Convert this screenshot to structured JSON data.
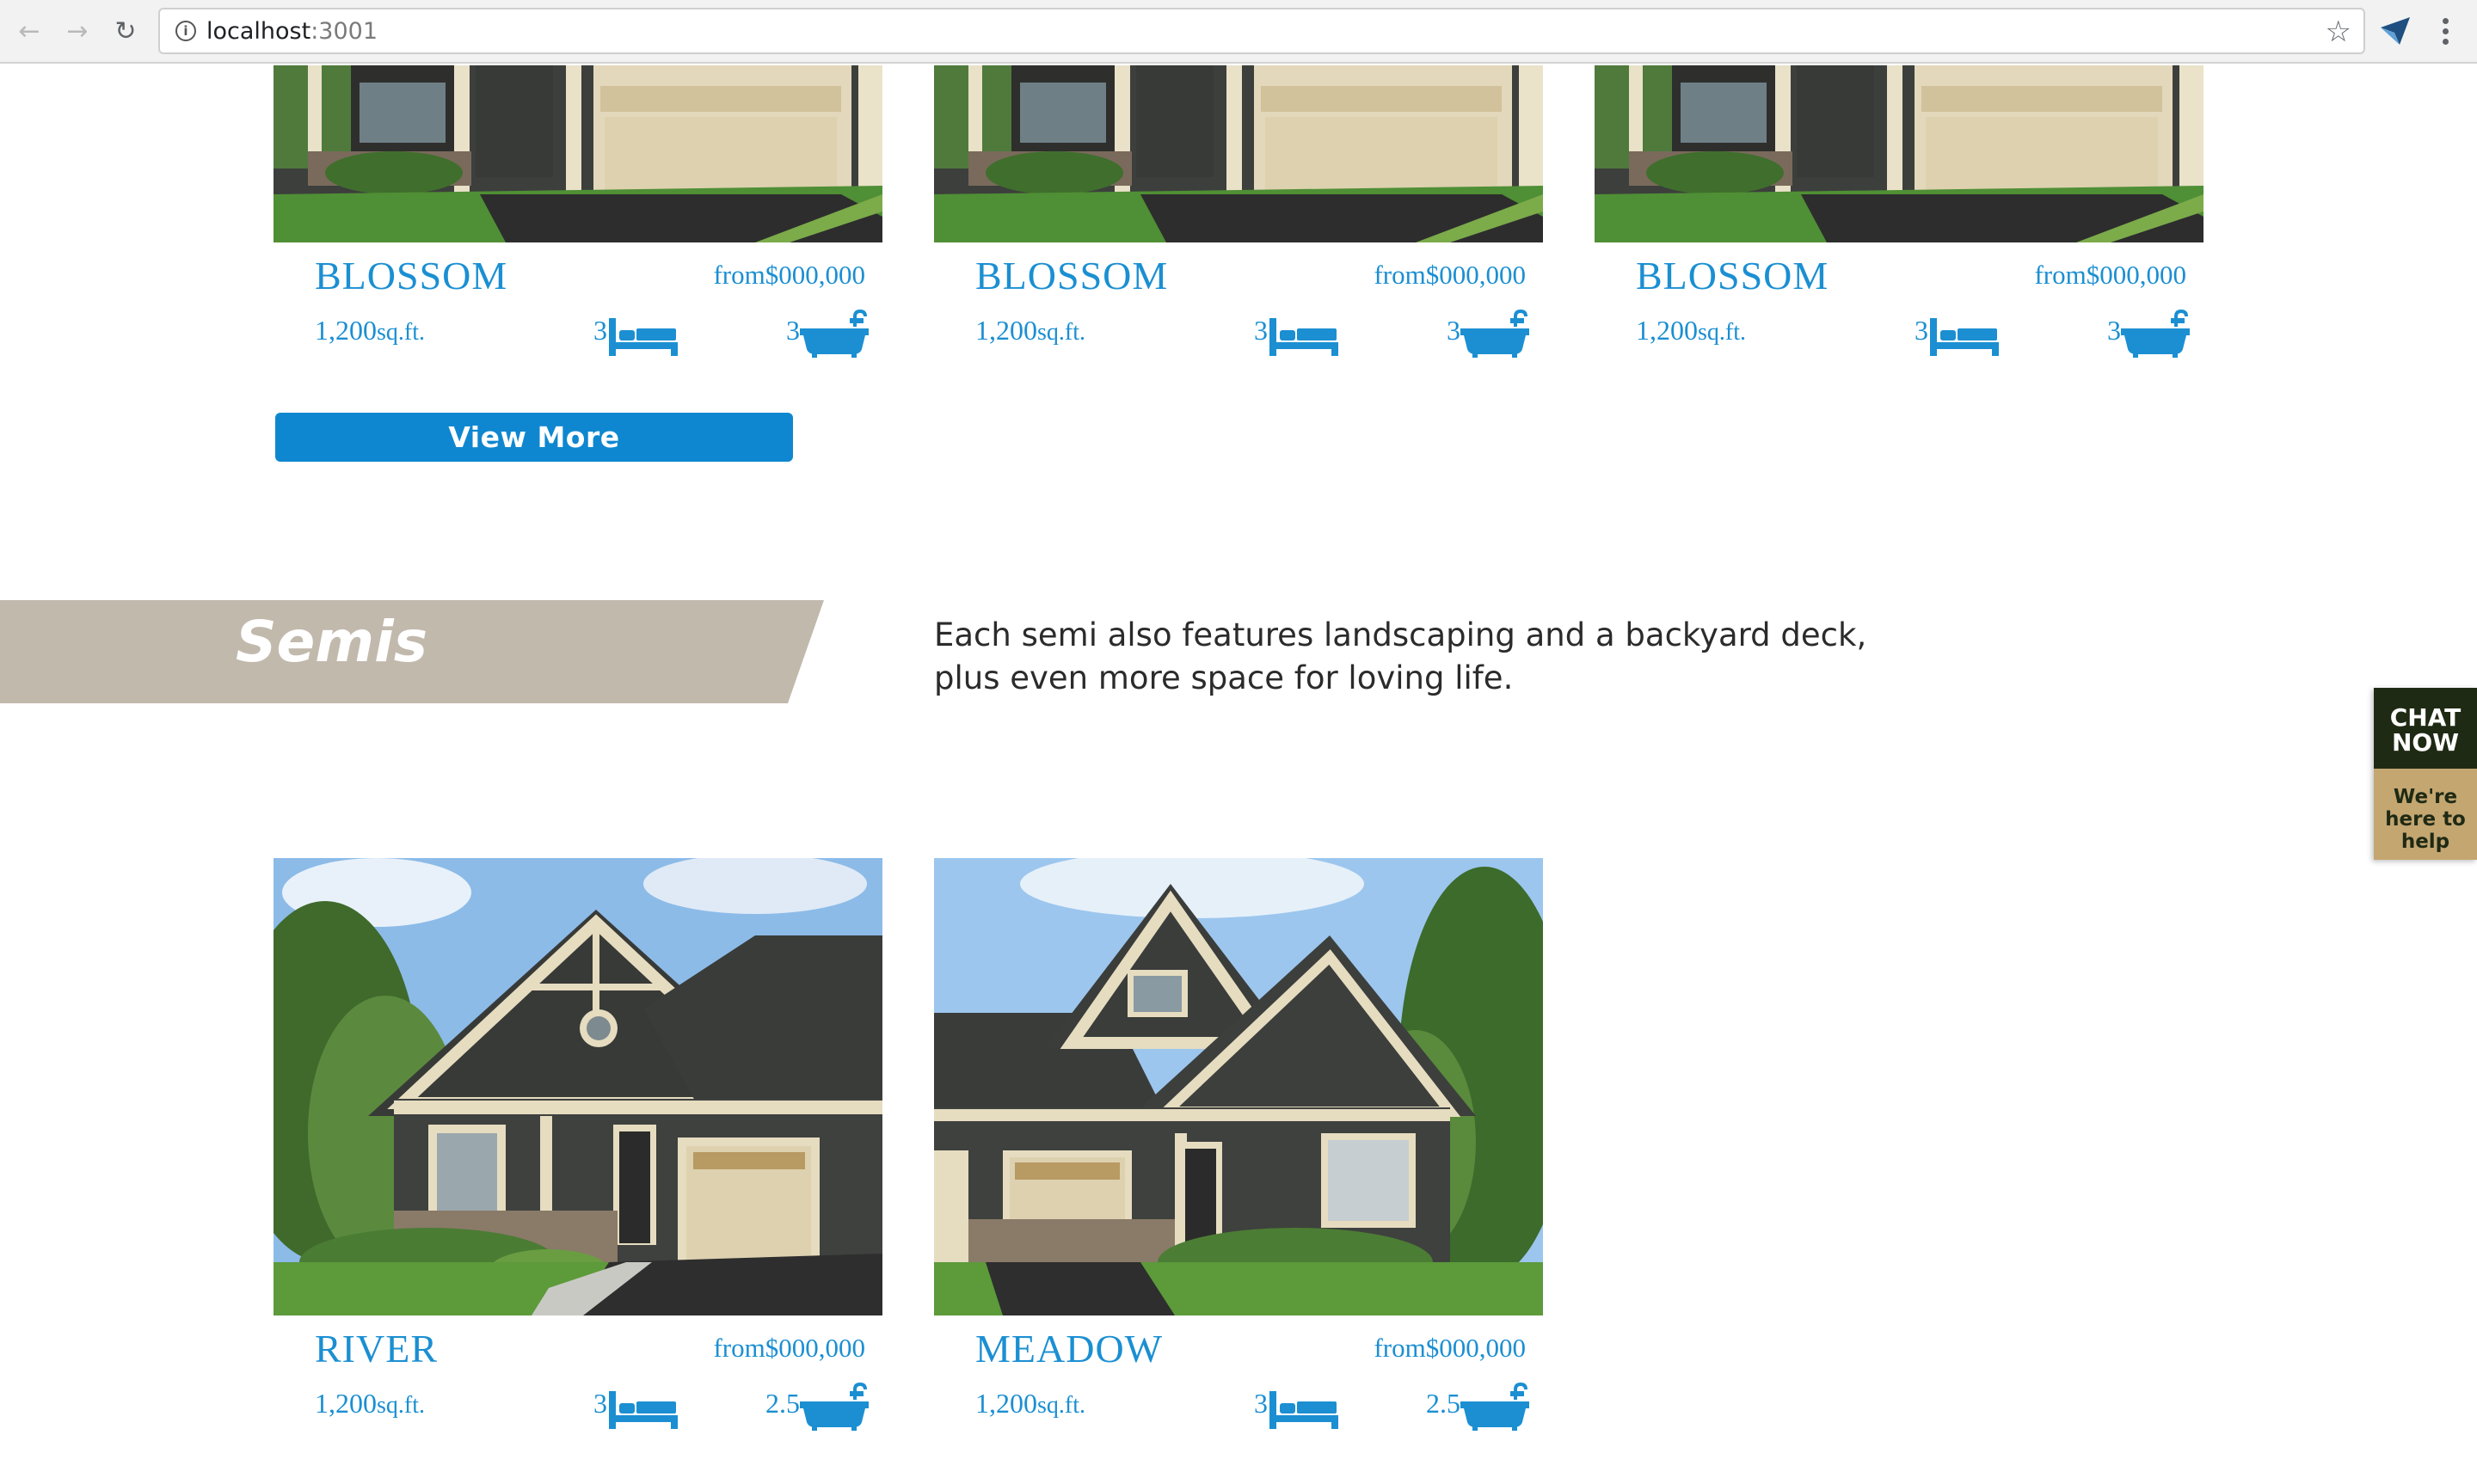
{
  "browser": {
    "url_host": "localhost",
    "url_port": ":3001",
    "nav_icons": [
      "back-arrow-icon",
      "forward-arrow-icon",
      "reload-icon"
    ],
    "info_icon": "info-icon",
    "bookmark_icon": "star-icon",
    "extension_icon": "extension-icon",
    "menu_icon": "kebab-menu-icon"
  },
  "singles": {
    "cards": [
      {
        "name": "BLOSSOM",
        "price": "from$000,000",
        "sqft_value": "1,200",
        "sqft_unit": "sq.ft.",
        "beds": "3",
        "baths": "3"
      },
      {
        "name": "BLOSSOM",
        "price": "from$000,000",
        "sqft_value": "1,200",
        "sqft_unit": "sq.ft.",
        "beds": "3",
        "baths": "3"
      },
      {
        "name": "BLOSSOM",
        "price": "from$000,000",
        "sqft_value": "1,200",
        "sqft_unit": "sq.ft.",
        "beds": "3",
        "baths": "3"
      }
    ],
    "view_more_label": "View More"
  },
  "semis": {
    "title": "Semis",
    "description_line1": "Each semi also features landscaping and a backyard deck,",
    "description_line2": "plus even more space for loving life.",
    "cards": [
      {
        "name": "RIVER",
        "price": "from$000,000",
        "sqft_value": "1,200",
        "sqft_unit": "sq.ft.",
        "beds": "3",
        "baths": "2.5"
      },
      {
        "name": "MEADOW",
        "price": "from$000,000",
        "sqft_value": "1,200",
        "sqft_unit": "sq.ft.",
        "beds": "3",
        "baths": "2.5"
      }
    ]
  },
  "chat_widget": {
    "line1": "CHAT",
    "line2": "NOW",
    "sub1": "We're",
    "sub2": "here to",
    "sub3": "help"
  },
  "colors": {
    "accent_blue": "#1b8fd2",
    "button_blue": "#0f87d0",
    "banner_tan": "#c2b9ad",
    "chat_dark": "#1f2a14",
    "chat_gold": "#c4a671"
  }
}
